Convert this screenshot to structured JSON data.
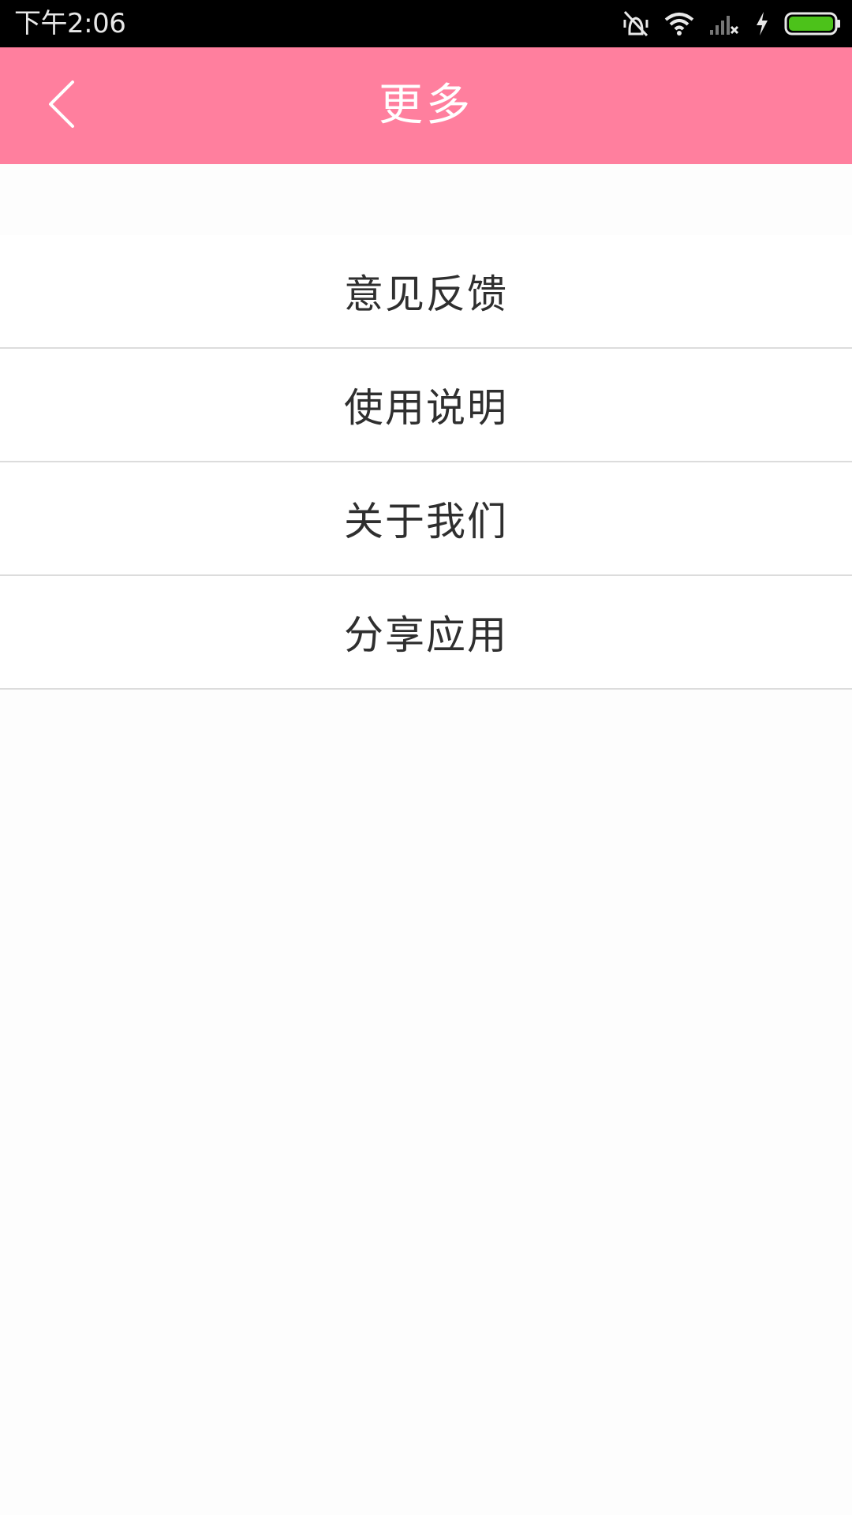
{
  "status_bar": {
    "time": "下午2:06",
    "icons": [
      "vibrate-off-icon",
      "wifi-icon",
      "signal-no-service-icon",
      "charging-icon",
      "battery-full-icon"
    ],
    "battery_color": "#4cc21a"
  },
  "header": {
    "title": "更多",
    "back_icon": "chevron-left-icon",
    "background_color": "#ff7f9e"
  },
  "menu": {
    "items": [
      {
        "label": "意见反馈"
      },
      {
        "label": "使用说明"
      },
      {
        "label": "关于我们"
      },
      {
        "label": "分享应用"
      }
    ]
  }
}
